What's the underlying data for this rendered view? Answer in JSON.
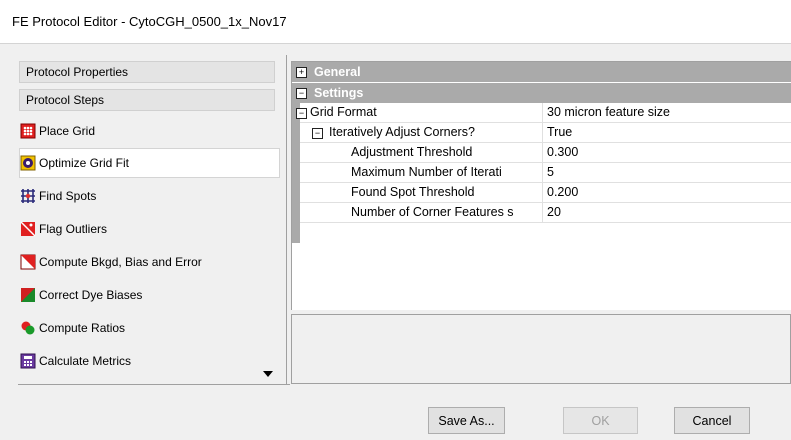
{
  "window": {
    "title": "FE Protocol Editor - CytoCGH_0500_1x_Nov17"
  },
  "left_panel": {
    "section_protocol_properties": "Protocol Properties",
    "section_protocol_steps": "Protocol Steps",
    "steps": [
      {
        "label": "Place Grid",
        "icon": "grid-icon"
      },
      {
        "label": "Optimize Grid Fit",
        "icon": "optimize-icon",
        "selected": true
      },
      {
        "label": "Find Spots",
        "icon": "spots-icon"
      },
      {
        "label": "Flag Outliers",
        "icon": "flag-icon"
      },
      {
        "label": "Compute Bkgd, Bias and Error",
        "icon": "background-icon"
      },
      {
        "label": "Correct Dye Biases",
        "icon": "dye-icon"
      },
      {
        "label": "Compute Ratios",
        "icon": "ratios-icon"
      },
      {
        "label": "Calculate Metrics",
        "icon": "metrics-icon"
      }
    ]
  },
  "property_grid": {
    "categories": [
      {
        "label": "General",
        "expanded": false
      },
      {
        "label": "Settings",
        "expanded": true
      }
    ],
    "rows": [
      {
        "name": "Grid Format",
        "value": "30 micron feature size",
        "toggle": "minus"
      },
      {
        "name": "Iteratively Adjust Corners?",
        "value": "True",
        "toggle": "minus"
      },
      {
        "name": "Adjustment Threshold",
        "value": "0.300"
      },
      {
        "name": "Maximum Number of Iterati",
        "value": "5"
      },
      {
        "name": "Found Spot Threshold",
        "value": "0.200"
      },
      {
        "name": "Number of Corner Features s",
        "value": "20"
      }
    ]
  },
  "buttons": {
    "save_as": "Save As...",
    "ok": "OK",
    "cancel": "Cancel"
  },
  "colors": {
    "category_bg": "#aaaaaa",
    "window_bg": "#f0f0f0",
    "selected_step_bg": "#ffffff"
  }
}
